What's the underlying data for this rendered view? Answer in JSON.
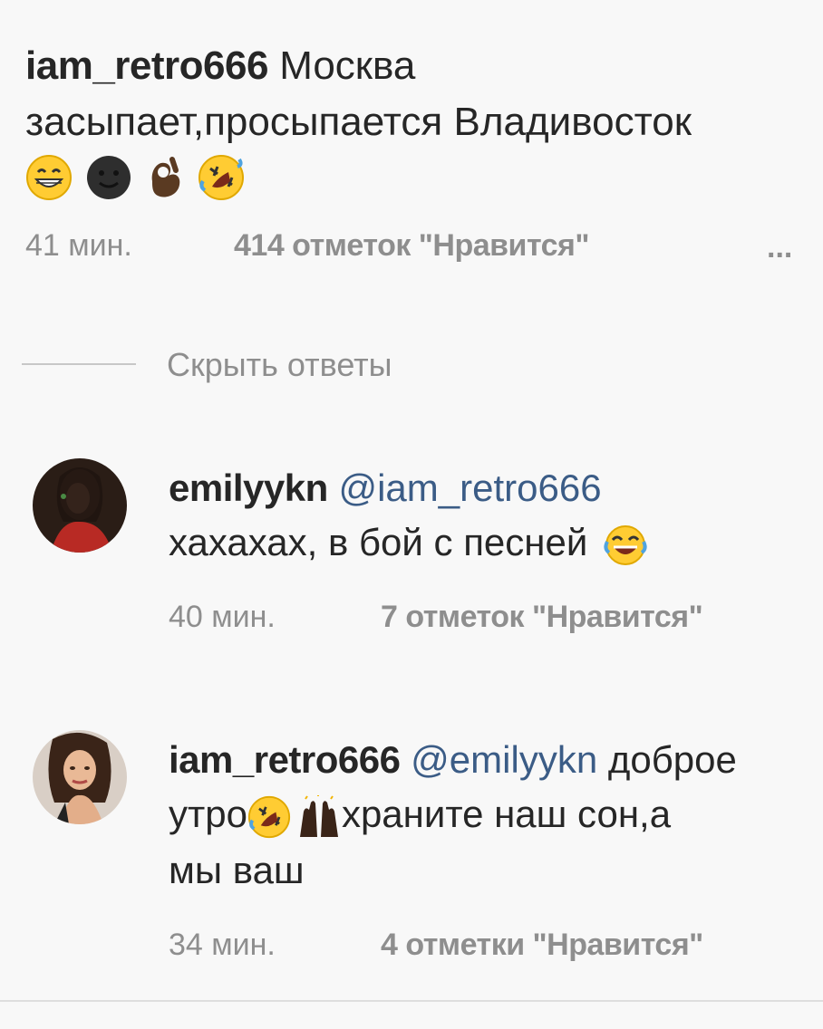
{
  "comment_main": {
    "username": "iam_retro666",
    "text_line1": "Москва",
    "text_line2": "засыпает,просыпается Владивосток",
    "emojis": [
      "grinning-face-with-smiling-eyes",
      "new-moon-face",
      "ok-hand-dark-skin-tone",
      "rolling-on-the-floor-laughing"
    ],
    "time": "41 мин.",
    "likes": "414 отметок \"Нравится\"",
    "more": "..."
  },
  "replies_toggle": {
    "label": "Скрыть ответы"
  },
  "reply_1": {
    "username": "emilyykn",
    "mention": "@iam_retro666",
    "text": "хахахах, в бой с песней",
    "emoji": "face-with-tears-of-joy",
    "time": "40 мин.",
    "likes": "7 отметок \"Нравится\""
  },
  "reply_2": {
    "username": "iam_retro666",
    "mention": "@emilyykn",
    "text_part1": "доброе",
    "text_part2": "утро",
    "text_part3": "храните наш сон,а",
    "text_part4": "мы ваш",
    "emojis": [
      "rolling-on-the-floor-laughing",
      "raising-hands-dark-skin-tone"
    ],
    "time": "34 мин.",
    "likes": "4 отметки \"Нравится\""
  },
  "colors": {
    "background": "#f8f8f8",
    "text": "#262626",
    "muted": "#8e8e8e",
    "mention": "#3b5c86"
  }
}
